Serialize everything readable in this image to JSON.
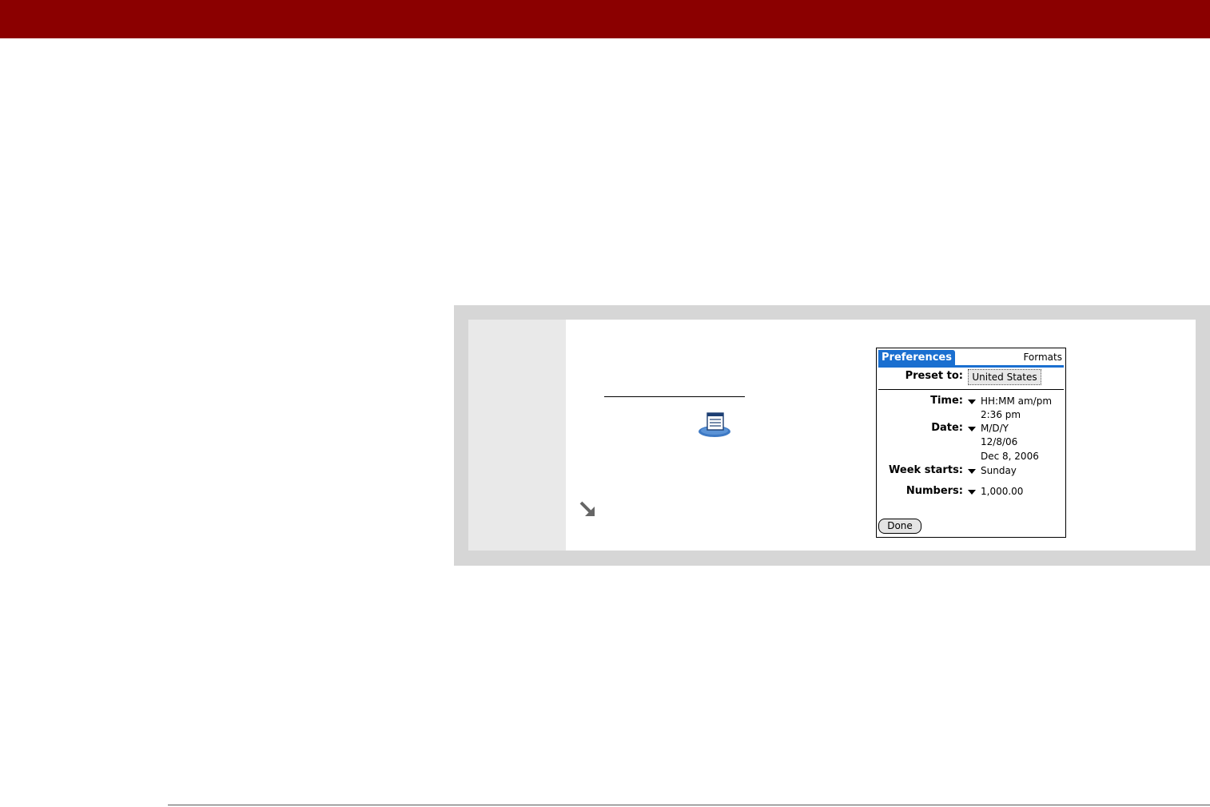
{
  "colors": {
    "header_bar": "#8b0000",
    "panel_bg": "#d6d6d6",
    "palm_accent": "#1a6fd0"
  },
  "icons": {
    "prefs_app": "preferences-app-icon",
    "tip": "tip-arrow-icon"
  },
  "palm": {
    "title": "Preferences",
    "menu": "Formats",
    "preset_label": "Preset to:",
    "preset_value": "United States",
    "time_label": "Time:",
    "time_format": "HH:MM am/pm",
    "time_example": "2:36 pm",
    "date_label": "Date:",
    "date_format": "M/D/Y",
    "date_example_short": "12/8/06",
    "date_example_long": "Dec 8, 2006",
    "week_label": "Week starts:",
    "week_value": "Sunday",
    "numbers_label": "Numbers:",
    "numbers_value": "1,000.00",
    "done_label": "Done"
  }
}
